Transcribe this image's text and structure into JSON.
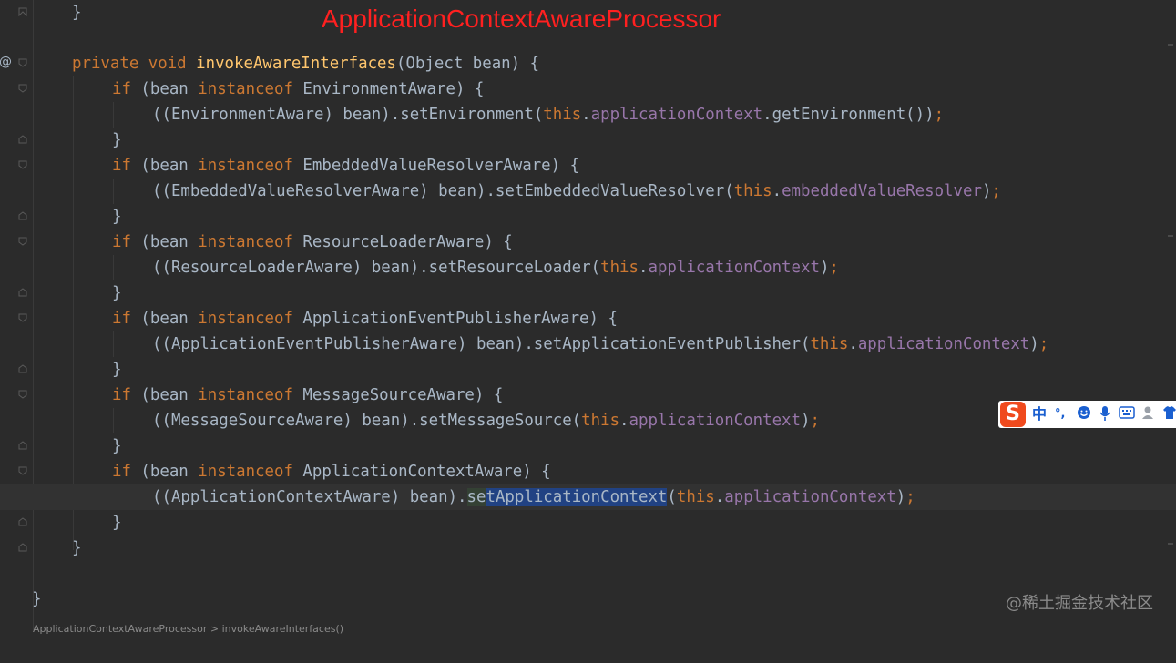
{
  "annotation": {
    "title": "ApplicationContextAwareProcessor"
  },
  "watermark": "@稀土掘金技术社区",
  "gutter": {
    "at_marker": "@"
  },
  "ime": {
    "logo": "S",
    "lang": "中",
    "punct": "°,"
  },
  "code": {
    "l0_brace": "}",
    "l1": {
      "kw1": "private void ",
      "fn": "invokeAwareInterfaces",
      "rest": "(Object bean) {"
    },
    "l2": {
      "kw": "if",
      "a": " (bean ",
      "inst": "instanceof",
      "b": " EnvironmentAware) {"
    },
    "l3": {
      "a": "((EnvironmentAware) bean).setEnvironment(",
      "this": "this",
      "dot": ".",
      "field": "applicationContext",
      "b": ".getEnvironment())",
      "semi": ";"
    },
    "l4": "}",
    "l5": {
      "kw": "if",
      "a": " (bean ",
      "inst": "instanceof",
      "b": " EmbeddedValueResolverAware) {"
    },
    "l6": {
      "a": "((EmbeddedValueResolverAware) bean).setEmbeddedValueResolver(",
      "this": "this",
      "dot": ".",
      "field": "embeddedValueResolver",
      "b": ")",
      "semi": ";"
    },
    "l7": "}",
    "l8": {
      "kw": "if",
      "a": " (bean ",
      "inst": "instanceof",
      "b": " ResourceLoaderAware) {"
    },
    "l9": {
      "a": "((ResourceLoaderAware) bean).setResourceLoader(",
      "this": "this",
      "dot": ".",
      "field": "applicationContext",
      "b": ")",
      "semi": ";"
    },
    "l10": "}",
    "l11": {
      "kw": "if",
      "a": " (bean ",
      "inst": "instanceof",
      "b": " ApplicationEventPublisherAware) {"
    },
    "l12": {
      "a": "((ApplicationEventPublisherAware) bean).setApplicationEventPublisher(",
      "this": "this",
      "dot": ".",
      "field": "applicationContext",
      "b": ")",
      "semi": ";"
    },
    "l13": "}",
    "l14": {
      "kw": "if",
      "a": " (bean ",
      "inst": "instanceof",
      "b": " MessageSourceAware) {"
    },
    "l15": {
      "a": "((MessageSourceAware) bean).setMessageSource(",
      "this": "this",
      "dot": ".",
      "field": "applicationContext",
      "b": ")",
      "semi": ";"
    },
    "l16": "}",
    "l17": {
      "kw": "if",
      "a": " (bean ",
      "inst": "instanceof",
      "b": " ApplicationContextAware) {"
    },
    "l18": {
      "a": "((ApplicationContextAware) bean).",
      "se": "se",
      "sel": "tApplicationContext",
      "paren": "(",
      "this": "this",
      "dot": ".",
      "field": "applicationContext",
      "b": ")",
      "semi": ";"
    },
    "l19": "}",
    "l20": "}",
    "l22": "}"
  },
  "bottom_hint": "ApplicationContextAwareProcessor > invokeAwareInterfaces()",
  "colors": {
    "background": "#2b2b2b",
    "keyword": "#cc7832",
    "method_decl": "#ffc66d",
    "field": "#9876aa",
    "text": "#a9b7c6",
    "selection": "#214283",
    "annotation": "#ff2020"
  }
}
